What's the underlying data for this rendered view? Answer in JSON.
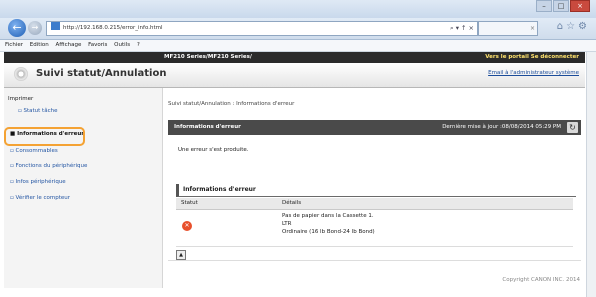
{
  "browser": {
    "url": "http://192.168.0.215/error_info.html",
    "address_tools": "⌕ ▾ ↑ ×",
    "menu": [
      "Fichier",
      "Edition",
      "Affichage",
      "Favoris",
      "Outils",
      "?"
    ]
  },
  "header": {
    "model": "MF210 Series/MF210 Series/",
    "portal_link": "Vers le portail  Se déconnecter",
    "page_title": "Suivi statut/Annulation",
    "mail_link": "Email à l'administrateur système"
  },
  "sidebar": {
    "section": "Imprimer",
    "items": [
      {
        "label": "Statut tâche"
      },
      {
        "label": "Informations d'erreur"
      },
      {
        "label": "Consommables"
      },
      {
        "label": "Fonctions du périphérique"
      },
      {
        "label": "Infos périphérique"
      },
      {
        "label": "Vérifier le compteur"
      }
    ]
  },
  "main": {
    "breadcrumb": "Suivi statut/Annulation : Informations d'erreur",
    "bar_title": "Informations d'erreur",
    "last_update": "Dernière mise à jour :08/08/2014 05:29 PM",
    "message": "Une erreur s'est produite.",
    "section_title": "Informations d'erreur",
    "col_status": "Statut",
    "col_details": "Détails",
    "detail_lines": [
      "Pas de papier dans la Cassette 1.",
      "LTR",
      "Ordinaire (16 lb Bond-24 lb Bond)"
    ]
  },
  "footer": {
    "copyright": "Copyright CANON INC. 2014"
  }
}
